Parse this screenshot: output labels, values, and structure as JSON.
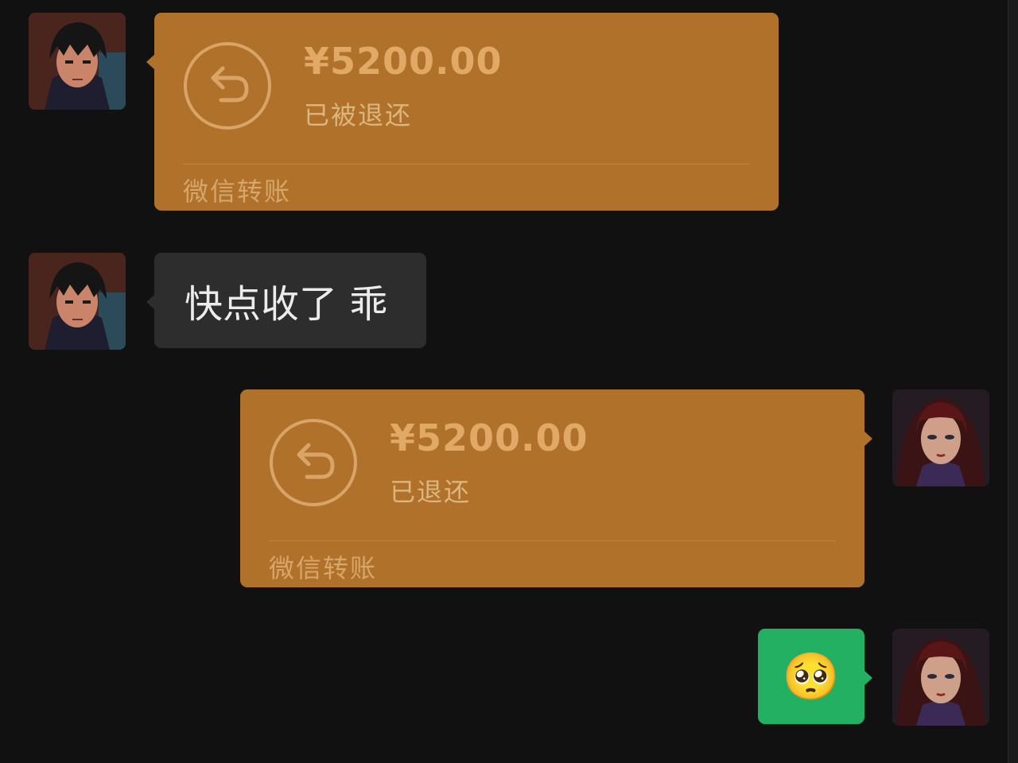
{
  "messages": [
    {
      "type": "transfer",
      "amount": "¥5200.00",
      "status": "已被退还",
      "footer": "微信转账"
    },
    {
      "type": "text",
      "text": "快点收了 乖"
    },
    {
      "type": "transfer",
      "amount": "¥5200.00",
      "status": "已退还",
      "footer": "微信转账"
    },
    {
      "type": "emoji",
      "emoji": "🥺"
    }
  ],
  "icons": {
    "transfer_icon": "return-arrow-icon",
    "avatar_left": "avatar",
    "avatar_right": "avatar"
  },
  "colors": {
    "background": "#111111",
    "transfer_bubble": "#b0722a",
    "text_bubble": "#2d2d2d",
    "emoji_bubble": "#24b062"
  }
}
